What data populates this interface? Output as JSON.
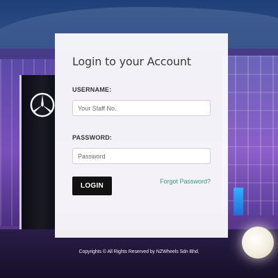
{
  "login": {
    "title": "Login to your Account",
    "username_label": "USERNAME:",
    "username_placeholder": "Your Staff No.",
    "username_value": "",
    "password_label": "PASSWORD:",
    "password_placeholder": "Password",
    "password_value": "",
    "login_button": "LOGIN",
    "forgot_password": "Forgot Password?"
  },
  "footer": {
    "copyright": "Copyrights © All Rights Reserved by NZWheels Sdn Bhd."
  },
  "theme": {
    "accent": "#2c9d77",
    "button": "#121212",
    "card": "#ffffff"
  },
  "icons": {
    "background_logo": "three-pointed-star-icon"
  }
}
